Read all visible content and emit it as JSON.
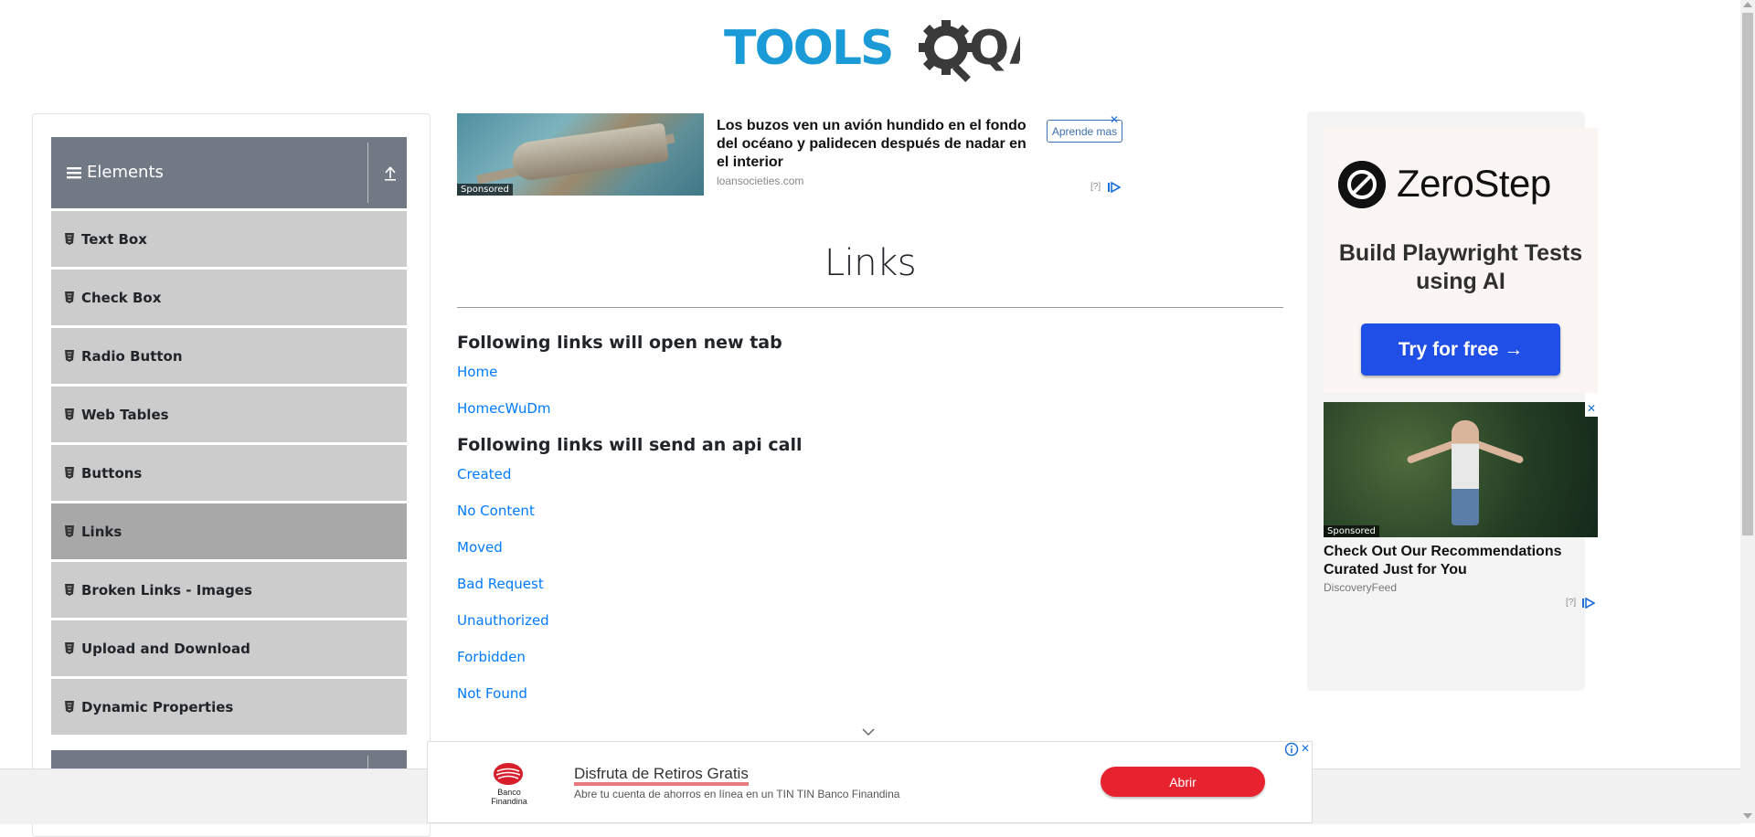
{
  "logo": {
    "text_tools": "TOOLS",
    "text_qa": "QA",
    "colors": {
      "tools": "#1a9ad6",
      "qa": "#3a3a3a"
    }
  },
  "sidebar": {
    "group_title": "Elements",
    "group_icon": "hamburger-icon",
    "collapse_icon": "collapse-up-icon",
    "items": [
      {
        "label": "Text Box",
        "active": false
      },
      {
        "label": "Check Box",
        "active": false
      },
      {
        "label": "Radio Button",
        "active": false
      },
      {
        "label": "Web Tables",
        "active": false
      },
      {
        "label": "Buttons",
        "active": false
      },
      {
        "label": "Links",
        "active": true
      },
      {
        "label": "Broken Links - Images",
        "active": false
      },
      {
        "label": "Upload and Download",
        "active": false
      },
      {
        "label": "Dynamic Properties",
        "active": false
      }
    ]
  },
  "top_ad": {
    "sponsored": "Sponsored",
    "title": "Los buzos ven un avión hundido en el fondo del océano y palidecen después de nadar en el interior",
    "domain": "loansocieties.com",
    "button": "Aprende mas",
    "help": "[?]"
  },
  "main": {
    "title": "Links",
    "section1_heading": "Following links will open new tab",
    "section1_links": [
      "Home",
      "HomecWuDm"
    ],
    "section2_heading": "Following links will send an api call",
    "section2_links": [
      "Created",
      "No Content",
      "Moved",
      "Bad Request",
      "Unauthorized",
      "Forbidden",
      "Not Found"
    ]
  },
  "right_ad": {
    "brand": "ZeroStep",
    "tagline": "Build Playwright Tests using AI",
    "cta": "Try for free →",
    "sponsored": "Sponsored",
    "ad2_title": "Check Out Our Recommendations Curated Just for You",
    "ad2_domain": "DiscoveryFeed",
    "help": "[?]"
  },
  "bottom_ad": {
    "brand": "Banco Finandina",
    "title": "Disfruta de Retiros Gratis",
    "subtitle": "Abre tu cuenta de ahorros en línea en un TIN TIN Banco Finandina",
    "button": "Abrir",
    "colors": {
      "button": "#e6232e"
    }
  },
  "colors": {
    "link": "#007bff",
    "sidebar_item": "#cccccc",
    "sidebar_active": "#a8a8a8",
    "group_header": "#707984",
    "cta": "#1f4fe6"
  }
}
